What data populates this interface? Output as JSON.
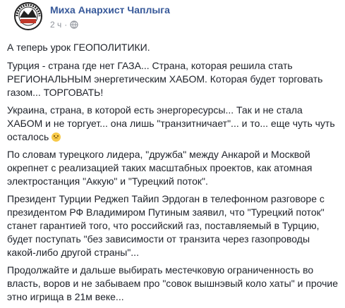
{
  "post": {
    "author": "Миха Анархист Чаплыга",
    "time": "2 ч",
    "separator": "·",
    "privacy_icon": "globe-icon",
    "paragraphs": [
      "А теперь урок ГЕОПОЛИТИКИ.",
      "Турция - страна где нет ГАЗА... Страна, которая решила стать РЕГИОНАЛЬНЫМ энергетическим ХАБОМ. Которая будет торговать газом... ТОРГОВАТЬ!",
      "Украина, страна, в которой есть энергоресурсы... Так и не стала ХАБОМ и не торгует... она лишь \"транзитничает\"... и то... еще чуть чуть осталось",
      "По словам турецкого лидера, \"дружба\" между Анкарой и Москвой окрепнет с реализацией таких масштабных проектов, как атомная электростанция \"Аккую\" и \"Турецкий поток\".",
      "Президент Турции Реджеп Тайип Эрдоган в телефонном разговоре с президентом РФ Владимиром Путиным заявил, что \"Турецкий поток\" станет гарантией того, что российский газ, поставляемый в Турцию, будет поступать \"без зависимости от транзита через газопроводы какой-либо другой страны\"...",
      "Продолжайте и дальше выбирать местечковую ограниченность во власть, воров и не забываем про \"совок вышнэвый коло хаты\" и прочие этно игрища в 21м веке..."
    ],
    "emoji": "sad-face-emoji"
  },
  "colors": {
    "author": "#365899",
    "meta": "#90949c",
    "text": "#1d2129",
    "emoji": "#f7c948"
  }
}
